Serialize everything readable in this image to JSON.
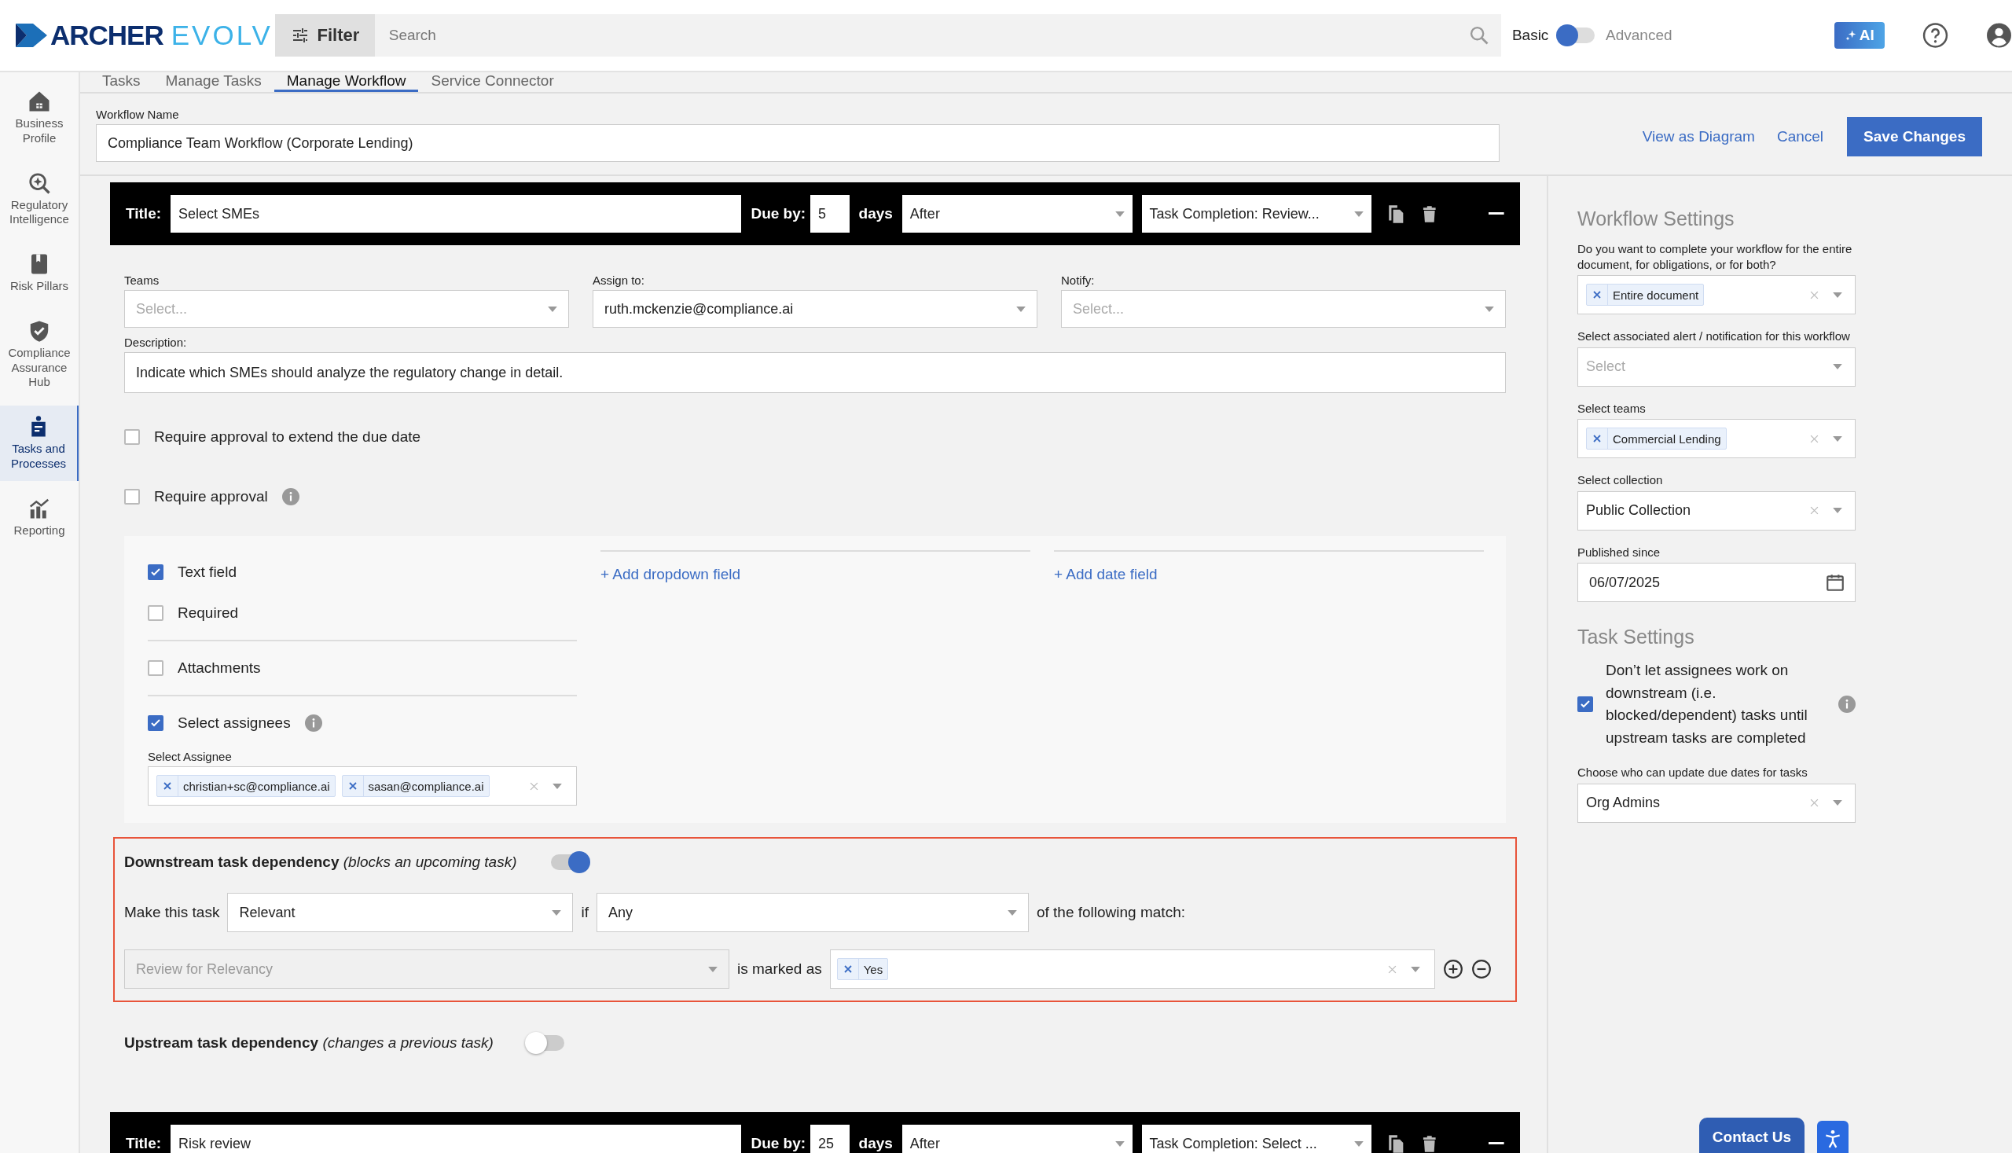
{
  "brand": {
    "name": "ARCHER",
    "suffix": "EVOLV"
  },
  "topbar": {
    "filter_label": "Filter",
    "search_placeholder": "Search",
    "mode_left": "Basic",
    "mode_right": "Advanced",
    "advanced": false,
    "ai_label": "AI"
  },
  "sidebar": {
    "items": [
      {
        "label": "Business Profile",
        "kind": "house",
        "selected": false
      },
      {
        "label": "Regulatory Intelligence",
        "kind": "magnifier",
        "selected": false
      },
      {
        "label": "Risk Pillars",
        "kind": "book",
        "selected": false
      },
      {
        "label": "Compliance Assurance Hub",
        "kind": "shield",
        "selected": false
      },
      {
        "label": "Tasks and Processes",
        "kind": "clipboard",
        "selected": true
      },
      {
        "label": "Reporting",
        "kind": "chart",
        "selected": false
      }
    ]
  },
  "tabs": [
    {
      "label": "Tasks",
      "selected": false
    },
    {
      "label": "Manage Tasks",
      "selected": false
    },
    {
      "label": "Manage Workflow",
      "selected": true
    },
    {
      "label": "Service Connector",
      "selected": false
    }
  ],
  "workflow_name": {
    "label": "Workflow Name",
    "value": "Compliance Team Workflow (Corporate Lending)"
  },
  "actions": {
    "view_diagram": "View as Diagram",
    "cancel": "Cancel",
    "save": "Save Changes"
  },
  "tasks": [
    {
      "title_label": "Title:",
      "title": "Select SMEs",
      "due_label": "Due by:",
      "due": "5",
      "days_label": "days",
      "relation": "After",
      "trigger": "Task Completion: Review...",
      "body": {
        "teams": {
          "label": "Teams",
          "placeholder": "Select..."
        },
        "assign": {
          "label": "Assign to:",
          "value": "ruth.mckenzie@compliance.ai"
        },
        "notify": {
          "label": "Notify:",
          "placeholder": "Select..."
        },
        "description": {
          "label": "Description:",
          "value": "Indicate which SMEs should analyze the regulatory change in detail."
        },
        "options": [
          {
            "label": "Require approval to extend the due date",
            "checked": false,
            "info": false
          },
          {
            "label": "Require approval",
            "checked": false,
            "info": true
          }
        ],
        "field_groups": [
          [
            {
              "label": "Text field",
              "checked": true,
              "info": false
            },
            {
              "label": "Required",
              "checked": false,
              "info": false
            }
          ],
          [
            {
              "label": "Attachments",
              "checked": false,
              "info": false
            }
          ],
          [
            {
              "label": "Select assignees",
              "checked": true,
              "info": true
            }
          ]
        ],
        "assignee_picker": {
          "label": "Select Assignee",
          "chips": [
            "christian+sc@compliance.ai",
            "sasan@compliance.ai"
          ]
        },
        "add_links": [
          "+ Add dropdown field",
          "+ Add date field"
        ],
        "downstream": {
          "label": "**Downstream task dependency** *(blocks an upcoming task)*",
          "on": true,
          "make_label": "Make this task",
          "state": "Relevant",
          "if_label": "if",
          "quantifier": "Any",
          "match_label": "of the following match:",
          "conditions": [
            {
              "task": "Review for Relevancy",
              "disabled": true,
              "is_label": "is marked as",
              "values": [
                "Yes"
              ]
            }
          ]
        },
        "upstream": {
          "label": "**Upstream task dependency** *(changes a previous task)*",
          "on": false
        }
      }
    },
    {
      "title_label": "Title:",
      "title": "Risk review",
      "due_label": "Due by:",
      "due": "25",
      "days_label": "days",
      "relation": "After",
      "trigger": "Task Completion: Select ..."
    }
  ],
  "workflow_settings": {
    "heading": "Workflow Settings",
    "fields": [
      {
        "kind": "multi",
        "label": "Do you want to complete your workflow for the entire document, for obligations, or for both?",
        "chips": [
          "Entire document"
        ]
      },
      {
        "kind": "select",
        "label": "Select associated alert / notification for this workflow",
        "placeholder": "Select"
      },
      {
        "kind": "multi",
        "label": "Select teams",
        "chips": [
          "Commercial Lending"
        ]
      },
      {
        "kind": "select",
        "label": "Select collection",
        "value": "Public Collection"
      },
      {
        "kind": "date",
        "label": "Published since",
        "value": "06/07/2025"
      }
    ]
  },
  "task_settings": {
    "heading": "Task Settings",
    "option": {
      "label": "Don’t let assignees work on downstream (i.e. blocked/dependent) tasks until upstream tasks are completed",
      "checked": true
    },
    "due_dates": {
      "label": "Choose who can update due dates for tasks",
      "value": "Org Admins"
    }
  },
  "contact": {
    "label": "Contact Us"
  }
}
